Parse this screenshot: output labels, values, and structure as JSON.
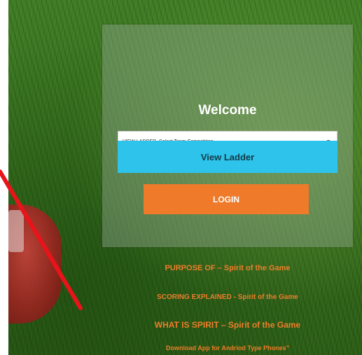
{
  "welcome": "Welcome",
  "competition_select": {
    "selected": "VIEW LADDER, Select Team Competition"
  },
  "buttons": {
    "view_ladder": "View Ladder",
    "login": "LOGIN"
  },
  "links": [
    "PURPOSE OF – Spirit of the Game",
    "SCORING EXPLAINED - Spirit of the Game",
    "WHAT IS SPIRIT – Spirit of the Game",
    "Download App for Andriod Type Phones\""
  ],
  "colors": {
    "view_ladder": "#2ec3ea",
    "login": "#ee7a2a",
    "links": "#ee7d2a",
    "annotation_line": "#e8141a"
  }
}
